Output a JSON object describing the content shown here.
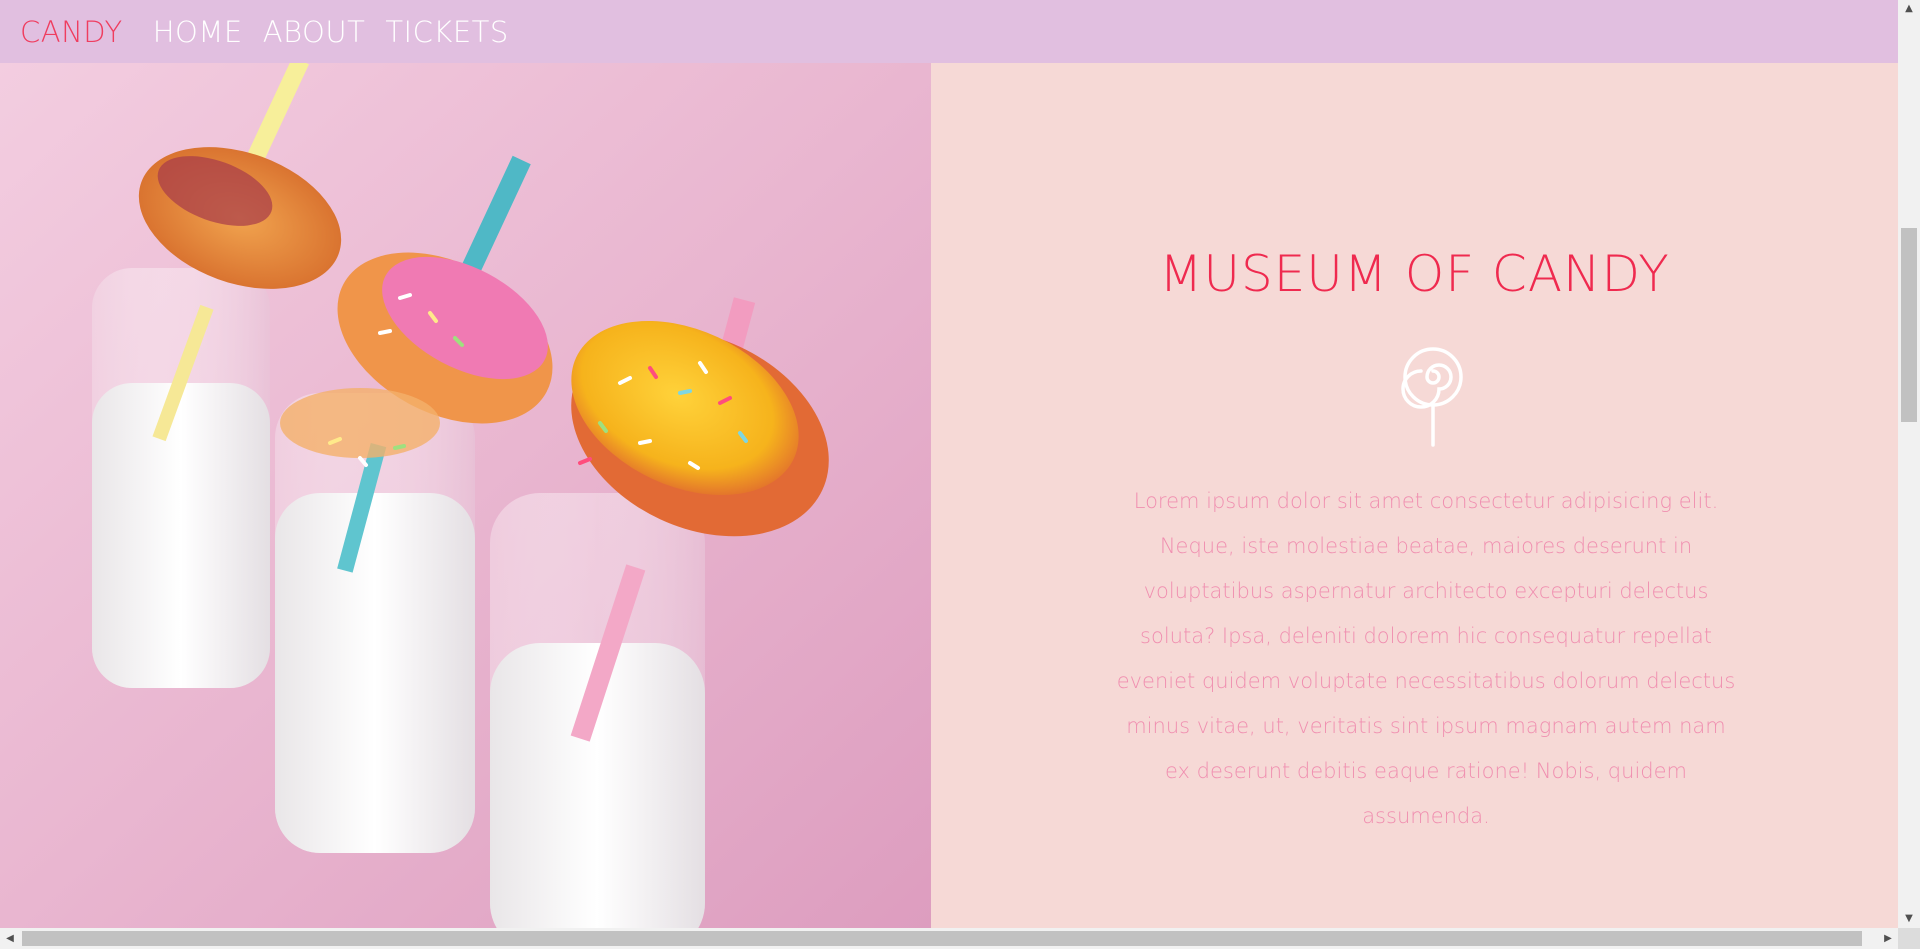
{
  "navbar": {
    "brand": "CANDY",
    "links": [
      "HOME",
      "ABOUT",
      "TICKETS"
    ]
  },
  "hero": {
    "image_subject": "donuts-on-milk-bottles"
  },
  "info": {
    "title": "MUSEUM OF CANDY",
    "icon": "lollipop-icon",
    "body": "Lorem ipsum dolor sit amet consectetur adipisicing elit. Neque, iste molestiae beatae, maiores deserunt in voluptatibus aspernatur architecto excepturi delectus soluta? Ipsa, deleniti dolorem hic consequatur repellat eveniet quidem voluptate necessitatibus dolorum delectus minus vitae, ut, veritatis sint ipsum magnam autem nam ex deserunt debitis eaque ratione! Nobis, quidem assumenda."
  },
  "scrollbars": {
    "up_arrow": "▲",
    "down_arrow": "▼",
    "left_arrow": "◀",
    "right_arrow": "▶"
  },
  "colors": {
    "navbar_bg": "#e1bfe0",
    "brand": "#ef3d5f",
    "panel_bg": "#f6d9d6",
    "title": "#ef2a4f",
    "body_text": "#f08fb0"
  }
}
